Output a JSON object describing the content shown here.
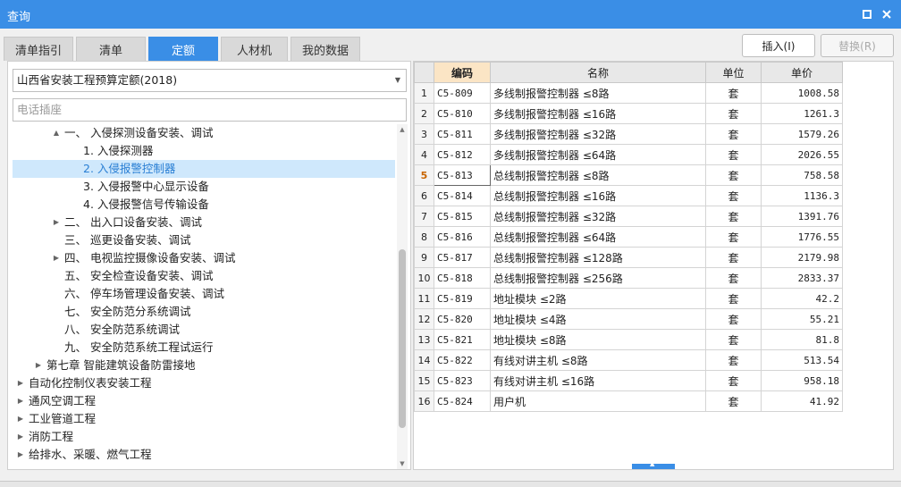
{
  "window": {
    "title": "查询"
  },
  "tabs": [
    "清单指引",
    "清单",
    "定额",
    "人材机",
    "我的数据"
  ],
  "buttons": {
    "insert": "插入(I)",
    "replace": "替换(R)"
  },
  "left": {
    "library": "山西省安装工程预算定额(2018)",
    "search_value": "电话插座"
  },
  "tree": [
    {
      "label": "一、 入侵探测设备安装、调试",
      "expand": "▲",
      "selected": false
    },
    {
      "label": "1. 入侵探测器",
      "expand": "",
      "selected": false
    },
    {
      "label": "2. 入侵报警控制器",
      "expand": "",
      "selected": true
    },
    {
      "label": "3. 入侵报警中心显示设备",
      "expand": "",
      "selected": false
    },
    {
      "label": "4. 入侵报警信号传输设备",
      "expand": "",
      "selected": false
    },
    {
      "label": "二、 出入口设备安装、调试",
      "expand": "▶",
      "selected": false
    },
    {
      "label": "三、 巡更设备安装、调试",
      "expand": "",
      "selected": false
    },
    {
      "label": "四、 电视监控摄像设备安装、调试",
      "expand": "▶",
      "selected": false
    },
    {
      "label": "五、 安全检查设备安装、调试",
      "expand": "",
      "selected": false
    },
    {
      "label": "六、 停车场管理设备安装、调试",
      "expand": "",
      "selected": false
    },
    {
      "label": "七、 安全防范分系统调试",
      "expand": "",
      "selected": false
    },
    {
      "label": "八、 安全防范系统调试",
      "expand": "",
      "selected": false
    },
    {
      "label": "九、 安全防范系统工程试运行",
      "expand": "",
      "selected": false
    },
    {
      "label": "第七章 智能建筑设备防雷接地",
      "expand": "▶",
      "selected": false
    },
    {
      "label": "自动化控制仪表安装工程",
      "expand": "▶",
      "selected": false
    },
    {
      "label": "通风空调工程",
      "expand": "▶",
      "selected": false
    },
    {
      "label": "工业管道工程",
      "expand": "▶",
      "selected": false
    },
    {
      "label": "消防工程",
      "expand": "▶",
      "selected": false
    },
    {
      "label": "给排水、采暖、燃气工程",
      "expand": "▶",
      "selected": false
    }
  ],
  "table": {
    "headers": {
      "index": "",
      "code": "编码",
      "name": "名称",
      "unit": "单位",
      "price": "单价"
    },
    "rows": [
      {
        "index": "1",
        "code": "C5-809",
        "name": "多线制报警控制器 ≤8路",
        "unit": "套",
        "price": "1008.58"
      },
      {
        "index": "2",
        "code": "C5-810",
        "name": "多线制报警控制器 ≤16路",
        "unit": "套",
        "price": "1261.3"
      },
      {
        "index": "3",
        "code": "C5-811",
        "name": "多线制报警控制器 ≤32路",
        "unit": "套",
        "price": "1579.26"
      },
      {
        "index": "4",
        "code": "C5-812",
        "name": "多线制报警控制器 ≤64路",
        "unit": "套",
        "price": "2026.55"
      },
      {
        "index": "5",
        "code": "C5-813",
        "name": "总线制报警控制器 ≤8路",
        "unit": "套",
        "price": "758.58"
      },
      {
        "index": "6",
        "code": "C5-814",
        "name": "总线制报警控制器 ≤16路",
        "unit": "套",
        "price": "1136.3"
      },
      {
        "index": "7",
        "code": "C5-815",
        "name": "总线制报警控制器 ≤32路",
        "unit": "套",
        "price": "1391.76"
      },
      {
        "index": "8",
        "code": "C5-816",
        "name": "总线制报警控制器 ≤64路",
        "unit": "套",
        "price": "1776.55"
      },
      {
        "index": "9",
        "code": "C5-817",
        "name": "总线制报警控制器 ≤128路",
        "unit": "套",
        "price": "2179.98"
      },
      {
        "index": "10",
        "code": "C5-818",
        "name": "总线制报警控制器 ≤256路",
        "unit": "套",
        "price": "2833.37"
      },
      {
        "index": "11",
        "code": "C5-819",
        "name": "地址模块 ≤2路",
        "unit": "套",
        "price": "42.2"
      },
      {
        "index": "12",
        "code": "C5-820",
        "name": "地址模块 ≤4路",
        "unit": "套",
        "price": "55.21"
      },
      {
        "index": "13",
        "code": "C5-821",
        "name": "地址模块 ≤8路",
        "unit": "套",
        "price": "81.8"
      },
      {
        "index": "14",
        "code": "C5-822",
        "name": "有线对讲主机 ≤8路",
        "unit": "套",
        "price": "513.54"
      },
      {
        "index": "15",
        "code": "C5-823",
        "name": "有线对讲主机 ≤16路",
        "unit": "套",
        "price": "958.18"
      },
      {
        "index": "16",
        "code": "C5-824",
        "name": "用户机",
        "unit": "套",
        "price": "41.92"
      }
    ],
    "current_row": "5"
  },
  "icons": {
    "restore": "restore-icon",
    "close": "close-icon"
  },
  "colors": {
    "accent": "#3a8ee6",
    "selected_bg": "#cfe8fc",
    "code_header": "#fbe5c5"
  }
}
